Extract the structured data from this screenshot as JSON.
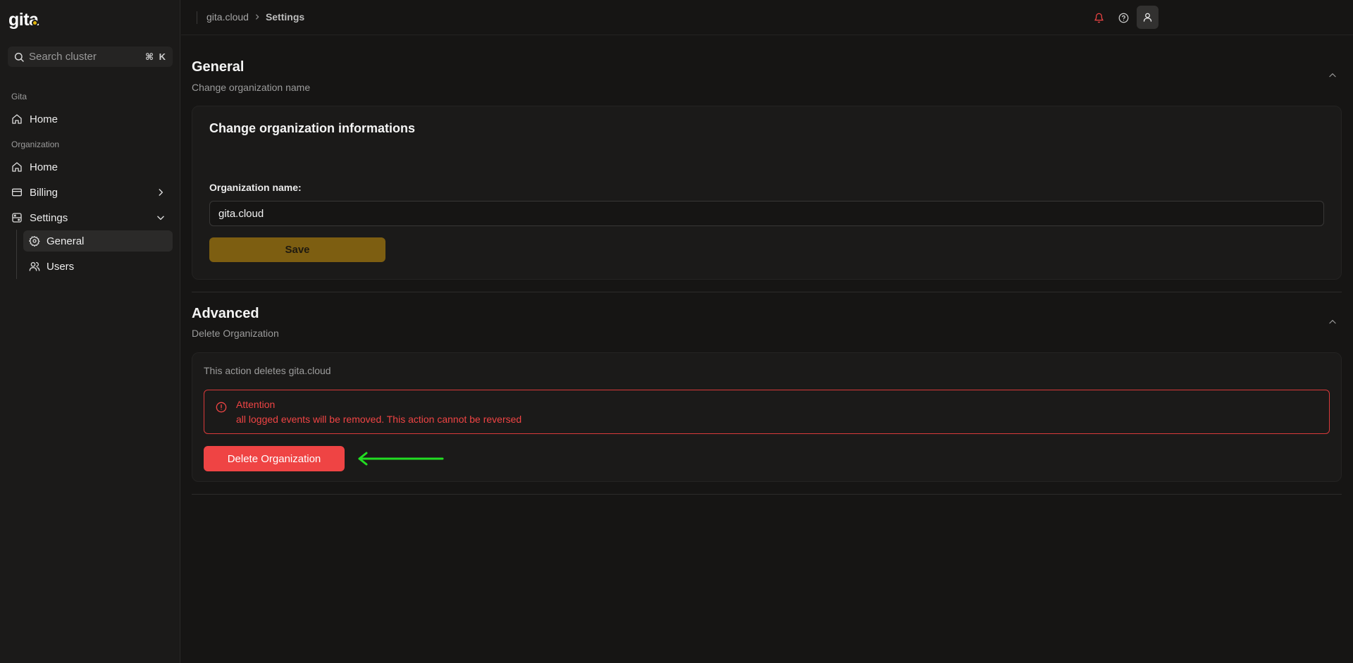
{
  "app": {
    "logo_text": "gita"
  },
  "search": {
    "placeholder": "Search cluster",
    "shortcut": "⌘ K"
  },
  "sidebar": {
    "groups": [
      {
        "label": "Gita",
        "items": [
          {
            "label": "Home",
            "icon": "home-icon"
          }
        ]
      },
      {
        "label": "Organization",
        "items": [
          {
            "label": "Home",
            "icon": "home-icon"
          },
          {
            "label": "Billing",
            "icon": "credit-card-icon",
            "chevron": "chevron-right-icon"
          },
          {
            "label": "Settings",
            "icon": "settings-panel-icon",
            "chevron": "chevron-down-icon",
            "children": [
              {
                "label": "General",
                "icon": "gear-icon",
                "active": true
              },
              {
                "label": "Users",
                "icon": "users-icon"
              }
            ]
          }
        ]
      }
    ]
  },
  "topbar": {
    "breadcrumb": {
      "parent": "gita.cloud",
      "current": "Settings"
    },
    "icons": [
      "bell-icon",
      "help-circle-icon",
      "user-icon"
    ]
  },
  "general": {
    "title": "General",
    "subtitle": "Change organization name",
    "card_title": "Change organization informations",
    "field_label": "Organization name:",
    "field_value": "gita.cloud",
    "save_label": "Save"
  },
  "advanced": {
    "title": "Advanced",
    "subtitle": "Delete Organization",
    "description": "This action deletes gita.cloud",
    "alert_title": "Attention",
    "alert_body": "all logged events will be removed. This action cannot be reversed",
    "delete_label": "Delete Organization"
  },
  "colors": {
    "accent_save": "#7d5e11",
    "danger": "#ef4444",
    "annotation_arrow": "#22dd22",
    "background": "#161514"
  }
}
